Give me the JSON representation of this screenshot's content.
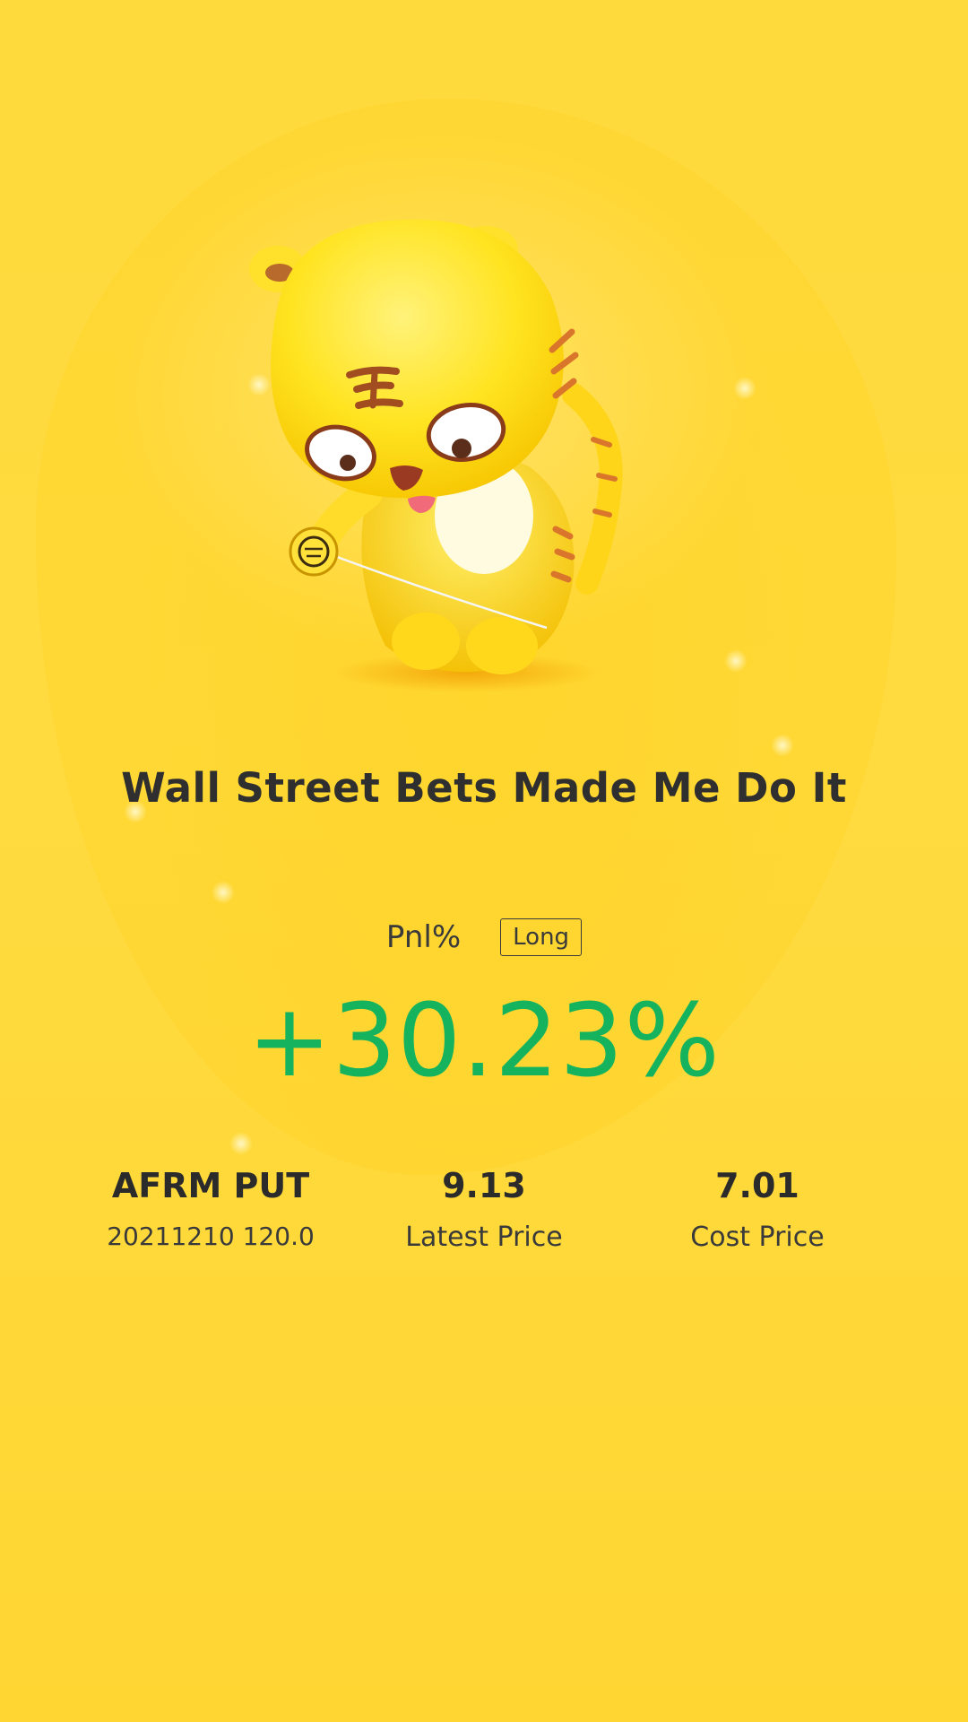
{
  "post": {
    "title": "Wall Street Bets Made Me Do It"
  },
  "pnl": {
    "label": "Pnl%",
    "direction": "Long",
    "value": "+30.23%",
    "color": "#16b35e"
  },
  "position": {
    "symbol": "AFRM PUT",
    "contract": "20211210 120.0",
    "latest_price": "9.13",
    "latest_price_label": "Latest Price",
    "cost_price": "7.01",
    "cost_price_label": "Cost Price"
  },
  "theme": {
    "background": "#ffda3c",
    "text": "#2b2b2b"
  },
  "mascot": {
    "icon": "tiger-mascot-yoyo"
  }
}
